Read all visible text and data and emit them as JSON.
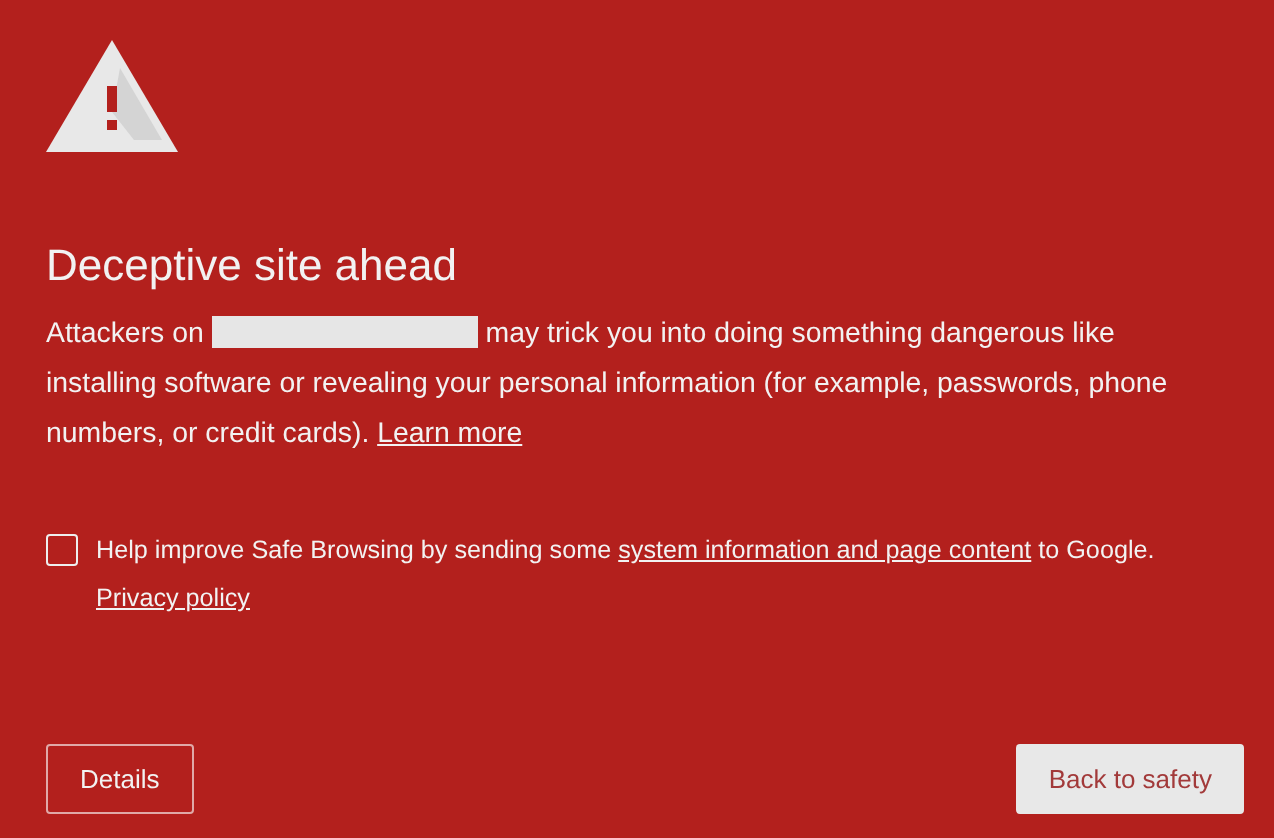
{
  "title": "Deceptive site ahead",
  "message": {
    "lead": "Attackers on",
    "redacted": true,
    "rest": "may trick you into doing something dangerous like installing software or revealing your personal information (for example, passwords, phone numbers, or credit cards).",
    "link": "Learn more"
  },
  "report": {
    "checked": false,
    "before": "Help improve Safe Browsing by sending some",
    "link": "system information and page content",
    "after": "to Google.",
    "privacy_link": "Privacy policy"
  },
  "buttons": [
    {
      "kind": "outline",
      "label": "Details"
    },
    {
      "kind": "primary",
      "label": "Back to safety"
    }
  ]
}
